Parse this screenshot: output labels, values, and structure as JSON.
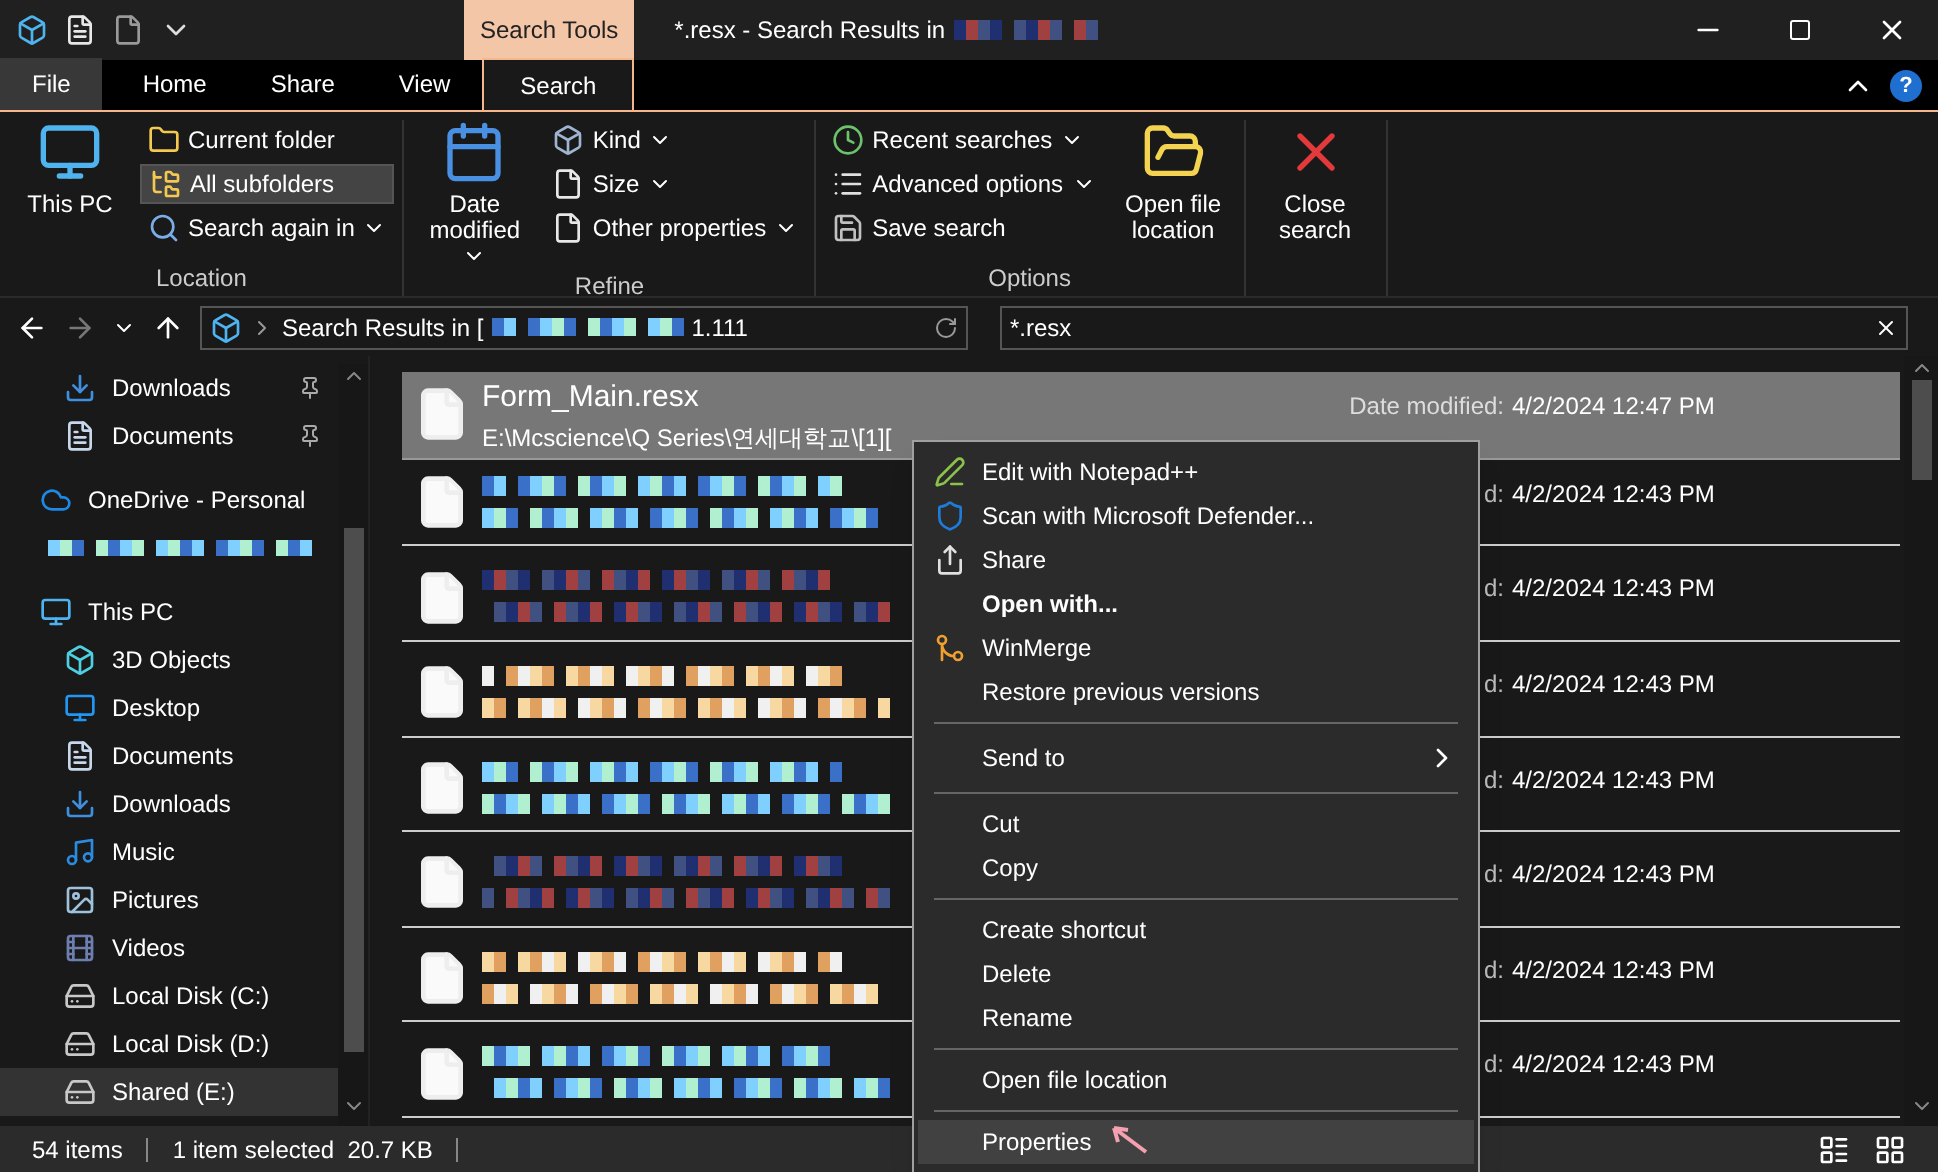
{
  "window": {
    "title": "*.resx - Search Results in",
    "context_tab": "Search Tools",
    "help": "?"
  },
  "ribbon_tabs": [
    {
      "label": "File",
      "selected": false
    },
    {
      "label": "Home",
      "selected": false
    },
    {
      "label": "Share",
      "selected": false
    },
    {
      "label": "View",
      "selected": false
    },
    {
      "label": "Search",
      "selected": true
    }
  ],
  "ribbon_groups": [
    {
      "label": "Location",
      "items": [
        {
          "kind": "large",
          "label": "This PC",
          "dropdown": false,
          "selected": false
        },
        {
          "kind": "small",
          "label": "Current folder",
          "dropdown": false,
          "selected": false
        },
        {
          "kind": "small",
          "label": "All subfolders",
          "dropdown": false,
          "selected": true
        },
        {
          "kind": "small",
          "label": "Search again in",
          "dropdown": true,
          "selected": false
        }
      ]
    },
    {
      "label": "Refine",
      "items": [
        {
          "kind": "large",
          "label": "Date modified",
          "dropdown": true,
          "selected": false
        },
        {
          "kind": "small",
          "label": "Kind",
          "dropdown": true,
          "selected": false
        },
        {
          "kind": "small",
          "label": "Size",
          "dropdown": true,
          "selected": false
        },
        {
          "kind": "small",
          "label": "Other properties",
          "dropdown": true,
          "selected": false
        }
      ]
    },
    {
      "label": "Options",
      "items": [
        {
          "kind": "small",
          "label": "Recent searches",
          "dropdown": true,
          "selected": false
        },
        {
          "kind": "small",
          "label": "Advanced options",
          "dropdown": true,
          "selected": false
        },
        {
          "kind": "small",
          "label": "Save search",
          "dropdown": false,
          "selected": false
        },
        {
          "kind": "large",
          "label": "Open file location",
          "dropdown": false,
          "selected": false
        }
      ]
    },
    {
      "items": [
        {
          "kind": "large",
          "label": "Close search",
          "dropdown": false,
          "selected": false
        }
      ]
    }
  ],
  "address": {
    "prefix": "Search Results in [",
    "suffix": "1.111"
  },
  "search": {
    "value": "*.resx"
  },
  "sidebar": {
    "quick_access": [
      {
        "label": "Downloads",
        "pinned": true,
        "selected": false
      },
      {
        "label": "Documents",
        "pinned": true,
        "selected": false
      }
    ],
    "onedrive": {
      "label": "OneDrive - Personal",
      "selected": false
    },
    "this_pc": {
      "label": "This PC",
      "selected": false,
      "children": [
        {
          "label": "3D Objects",
          "selected": false
        },
        {
          "label": "Desktop",
          "selected": false
        },
        {
          "label": "Documents",
          "selected": false
        },
        {
          "label": "Downloads",
          "selected": false
        },
        {
          "label": "Music",
          "selected": false
        },
        {
          "label": "Pictures",
          "selected": false
        },
        {
          "label": "Videos",
          "selected": false
        },
        {
          "label": "Local Disk (C:)",
          "selected": false
        },
        {
          "label": "Local Disk (D:)",
          "selected": false
        },
        {
          "label": "Shared (E:)",
          "selected": true
        }
      ]
    }
  },
  "results": [
    {
      "name": "Form_Main.resx",
      "path": "E:\\Mcscience\\Q Series\\연세대학교\\[1][",
      "date_label": "Date modified:",
      "date": "4/2/2024 12:47 PM",
      "selected": true
    },
    {
      "date_label": "d:",
      "date": "4/2/2024 12:43 PM",
      "selected": false
    },
    {
      "date_label": "d:",
      "date": "4/2/2024 12:43 PM",
      "selected": false
    },
    {
      "date_label": "d:",
      "date": "4/2/2024 12:43 PM",
      "selected": false
    },
    {
      "date_label": "d:",
      "date": "4/2/2024 12:43 PM",
      "selected": false
    },
    {
      "date_label": "d:",
      "date": "4/2/2024 12:43 PM",
      "selected": false
    },
    {
      "date_label": "d:",
      "date": "4/2/2024 12:43 PM",
      "selected": false
    },
    {
      "date_label": "d:",
      "date": "4/2/2024 12:43 PM",
      "selected": false
    }
  ],
  "context_menu": [
    {
      "kind": "item",
      "label": "Edit with Notepad++",
      "bold": false,
      "selected": false
    },
    {
      "kind": "item",
      "label": "Scan with Microsoft Defender...",
      "bold": false,
      "selected": false
    },
    {
      "kind": "item",
      "label": "Share",
      "bold": false,
      "selected": false
    },
    {
      "kind": "item",
      "label": "Open with...",
      "bold": true,
      "selected": false
    },
    {
      "kind": "item",
      "label": "WinMerge",
      "bold": false,
      "selected": false
    },
    {
      "kind": "item",
      "label": "Restore previous versions",
      "bold": false,
      "selected": false
    },
    {
      "kind": "separator"
    },
    {
      "kind": "submenu",
      "label": "Send to",
      "bold": false,
      "selected": false
    },
    {
      "kind": "separator"
    },
    {
      "kind": "item",
      "label": "Cut",
      "bold": false,
      "selected": false
    },
    {
      "kind": "item",
      "label": "Copy",
      "bold": false,
      "selected": false
    },
    {
      "kind": "separator"
    },
    {
      "kind": "item",
      "label": "Create shortcut",
      "bold": false,
      "selected": false
    },
    {
      "kind": "item",
      "label": "Delete",
      "bold": false,
      "selected": false
    },
    {
      "kind": "item",
      "label": "Rename",
      "bold": false,
      "selected": false
    },
    {
      "kind": "separator"
    },
    {
      "kind": "item",
      "label": "Open file location",
      "bold": false,
      "selected": false
    },
    {
      "kind": "separator"
    },
    {
      "kind": "item",
      "label": "Properties",
      "bold": false,
      "selected": true
    }
  ],
  "status_bar": {
    "count": "54 items",
    "selection": "1 item selected  20.7 KB"
  }
}
